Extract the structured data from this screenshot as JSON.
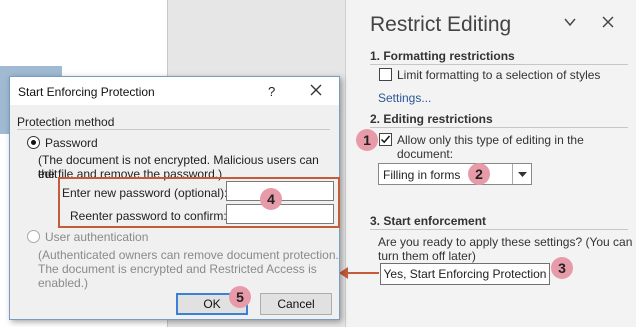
{
  "pane": {
    "title": "Restrict Editing",
    "section1_title": "1. Formatting restrictions",
    "limit_formatting_label": "Limit formatting to a selection of styles",
    "limit_formatting_checked": false,
    "settings_link": "Settings...",
    "section2_title": "2. Editing restrictions",
    "allow_editing_label_line1": "Allow only this type of editing in the",
    "allow_editing_label_line2": "document:",
    "allow_editing_checked": true,
    "editing_type_value": "Filling in forms",
    "section3_title": "3. Start enforcement",
    "enforcement_question_line1": "Are you ready to apply these settings? (You can",
    "enforcement_question_line2": "turn them off later)",
    "start_button_label": "Yes, Start Enforcing Protection"
  },
  "dialog": {
    "title": "Start Enforcing Protection",
    "help_label": "?",
    "group_label": "Protection method",
    "password_option": "Password",
    "password_selected": true,
    "password_note_line1": "(The document is not encrypted. Malicious users can edit",
    "password_note_line2": "the file and remove the password.)",
    "new_password_label": "Enter new password (optional):",
    "new_password_value": "",
    "confirm_password_label": "Reenter password to confirm:",
    "confirm_password_value": "",
    "user_auth_option": "User authentication",
    "user_auth_note_line1": "(Authenticated owners can remove document protection.",
    "user_auth_note_line2": "The document is encrypted and Restricted Access is",
    "user_auth_note_line3": "enabled.)",
    "ok_label": "OK",
    "cancel_label": "Cancel"
  },
  "badges": {
    "b1": "1",
    "b2": "2",
    "b3": "3",
    "b4": "4",
    "b5": "5"
  },
  "colors": {
    "accent_link": "#2b579a",
    "badge": "#e79aa8",
    "highlight": "#c65b3c",
    "default_button_border": "#3c7fd6"
  }
}
